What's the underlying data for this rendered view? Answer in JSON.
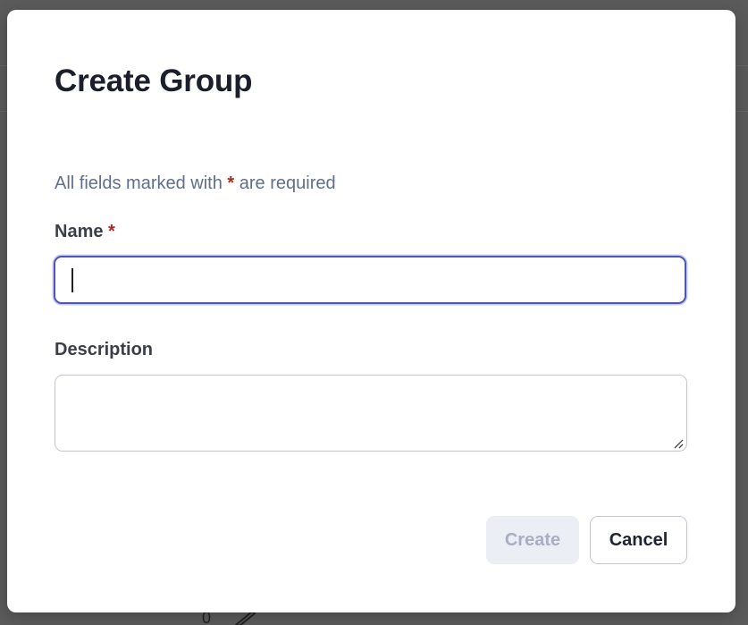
{
  "background": {
    "page_number": "0"
  },
  "modal": {
    "title": "Create Group",
    "required_note_prefix": "All fields marked with ",
    "required_note_asterisk": "*",
    "required_note_suffix": " are required",
    "fields": {
      "name": {
        "label": "Name",
        "required_marker": "*",
        "value": ""
      },
      "description": {
        "label": "Description",
        "value": ""
      }
    },
    "buttons": {
      "create_label": "Create",
      "cancel_label": "Cancel"
    }
  },
  "colors": {
    "accent": "#4a56b8",
    "required": "#b3261e",
    "disabled_button_bg": "#eceef5"
  }
}
